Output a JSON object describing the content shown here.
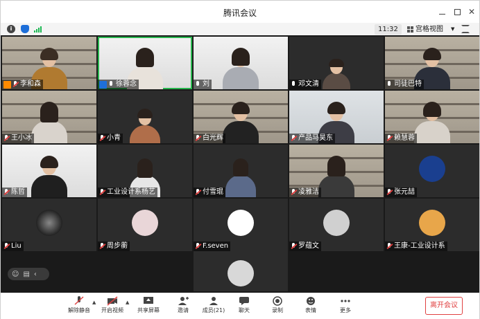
{
  "window": {
    "title": "腾讯会议"
  },
  "infobar": {
    "time": "11:32",
    "view_label": "宫格视图"
  },
  "participants": [
    {
      "name": "李和森"
    },
    {
      "name": "徐蓉念"
    },
    {
      "name": "刘"
    },
    {
      "name": "邓文清"
    },
    {
      "name": "司徒巴特"
    },
    {
      "name": "王小冰"
    },
    {
      "name": "小青"
    },
    {
      "name": "白光辉"
    },
    {
      "name": "产品马昊东"
    },
    {
      "name": "赖慧蓉"
    },
    {
      "name": "陈哲"
    },
    {
      "name": "工业设计系杨艺"
    },
    {
      "name": "付雪琨"
    },
    {
      "name": "凌雅洁"
    },
    {
      "name": "张元喆"
    },
    {
      "name": "Liu"
    },
    {
      "name": "周步蘅"
    },
    {
      "name": "F.seven"
    },
    {
      "name": "罗蕴文"
    },
    {
      "name": "王康-工业设计系"
    }
  ],
  "toolbar": {
    "unmute": "解除静音",
    "video": "开启视频",
    "share": "共享屏幕",
    "invite": "邀请",
    "members": "成员(21)",
    "chat": "聊天",
    "record": "录制",
    "reactions": "表情",
    "more": "更多",
    "leave": "离开会议"
  },
  "colors": {
    "accent": "#1e6fd9",
    "leave": "#e04040",
    "active_speaker": "#27b54d",
    "host_badge": "#ff8a00"
  }
}
